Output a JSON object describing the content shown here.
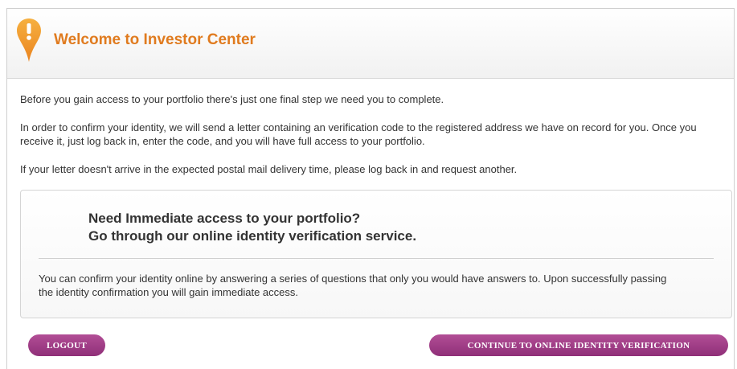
{
  "header": {
    "title": "Welcome to Investor Center",
    "icon": "alert-pin-icon",
    "icon_color": "#f29a2e"
  },
  "content": {
    "paragraph1": "Before you gain access to your portfolio there's just one final step we need you to complete.",
    "paragraph2": "In order to confirm your identity, we will send a letter containing an verification code to the registered address we have on record for you. Once you receive it, just log back in, enter the code, and you will have full access to your portfolio.",
    "paragraph3": "If your letter doesn't arrive in the expected postal mail delivery time, please log back in and request another."
  },
  "verification_box": {
    "heading_line1": "Need Immediate access to your portfolio?",
    "heading_line2": "Go through our online identity verification service.",
    "description": "You can confirm your identity online by answering a series of questions that only you would have answers to. Upon successfully passing the identity confirmation you will gain immediate access."
  },
  "buttons": {
    "logout_label": "LOGOUT",
    "continue_label": "CONTINUE TO ONLINE IDENTITY VERIFICATION",
    "color": "#9e3a86"
  },
  "colors": {
    "title": "#e07b1f"
  }
}
